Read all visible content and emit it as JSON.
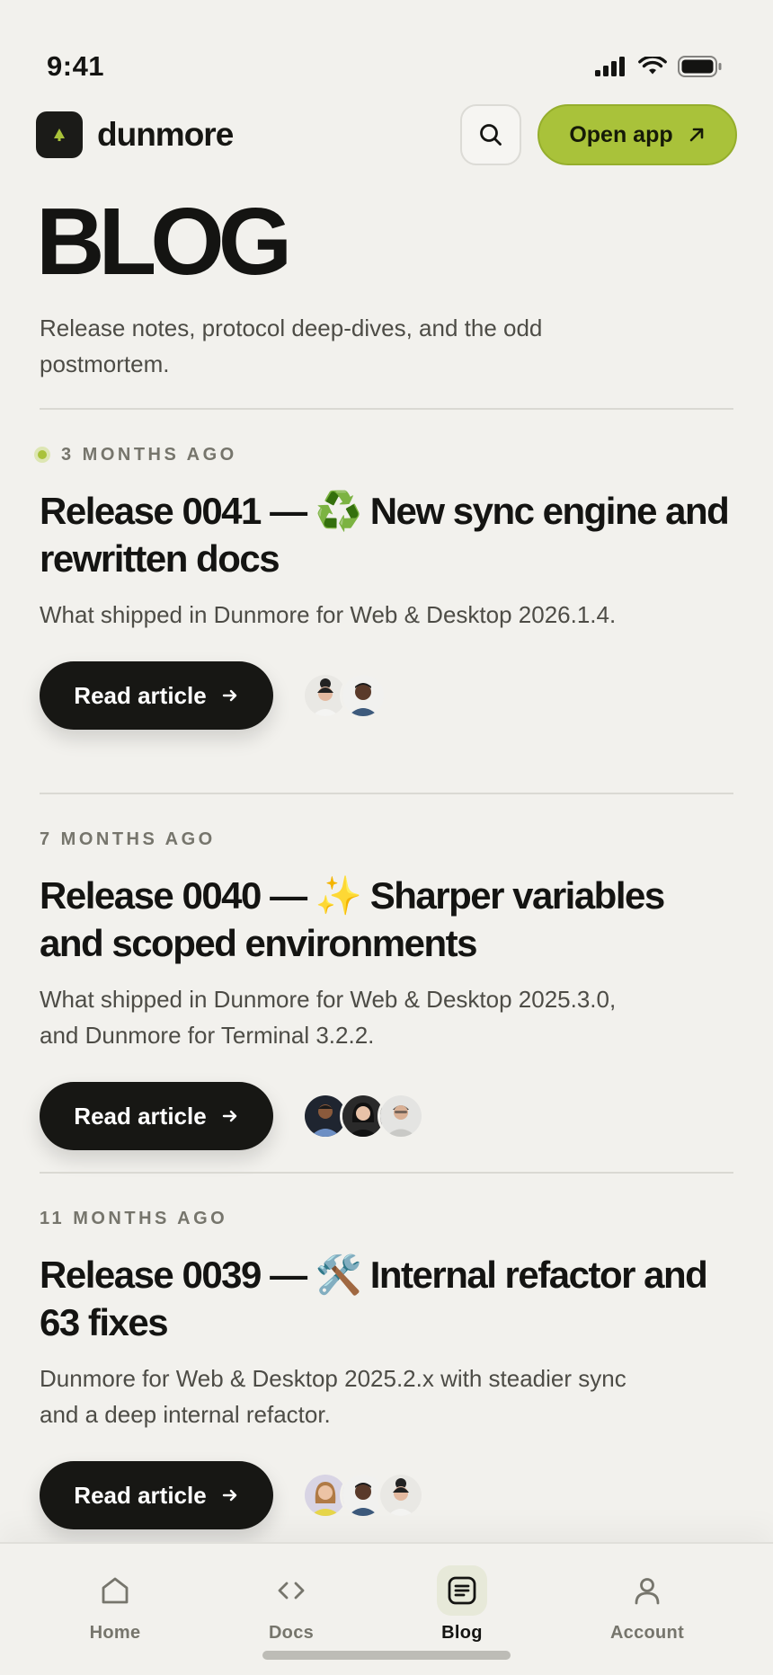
{
  "status_bar": {
    "time": "9:41"
  },
  "header": {
    "brand": "dunmore",
    "open_app_label": "Open app"
  },
  "hero": {
    "title": "BLOG",
    "subtitle": "Release notes, protocol deep-dives, and the odd postmortem."
  },
  "posts": [
    {
      "date": "3 MONTHS AGO",
      "title": "Release 0041 — ♻️ New sync engine and rewritten docs",
      "excerpt": "What shipped in Dunmore for Web & Desktop 2026.1.4.",
      "button_label": "Read article",
      "authors": [
        "avatar-author-1",
        "avatar-author-2"
      ]
    },
    {
      "date": "7 MONTHS AGO",
      "title": "Release 0040 — ✨ Sharper variables and scoped environments",
      "excerpt": "What shipped in Dunmore for Web & Desktop 2025.3.0, and Dunmore for Terminal 3.2.2.",
      "button_label": "Read article",
      "authors": [
        "avatar-author-1",
        "avatar-author-2",
        "avatar-author-3"
      ]
    },
    {
      "date": "11 MONTHS AGO",
      "title": "Release 0039 — 🛠️ Internal refactor and 63 fixes",
      "excerpt": "Dunmore for Web & Desktop 2025.2.x with steadier sync and a deep internal refactor.",
      "button_label": "Read article",
      "authors": [
        "avatar-author-1",
        "avatar-author-2",
        "avatar-author-3"
      ]
    }
  ],
  "tabbar": {
    "items": [
      {
        "label": "Home",
        "icon": "home-icon",
        "active": false
      },
      {
        "label": "Docs",
        "icon": "code-icon",
        "active": false
      },
      {
        "label": "Blog",
        "icon": "blog-icon",
        "active": true
      },
      {
        "label": "Account",
        "icon": "account-icon",
        "active": false
      }
    ]
  },
  "colors": {
    "background": "#f2f1ed",
    "accent": "#a9c23a",
    "text": "#141412",
    "muted": "#76756c",
    "button_dark": "#171714"
  }
}
